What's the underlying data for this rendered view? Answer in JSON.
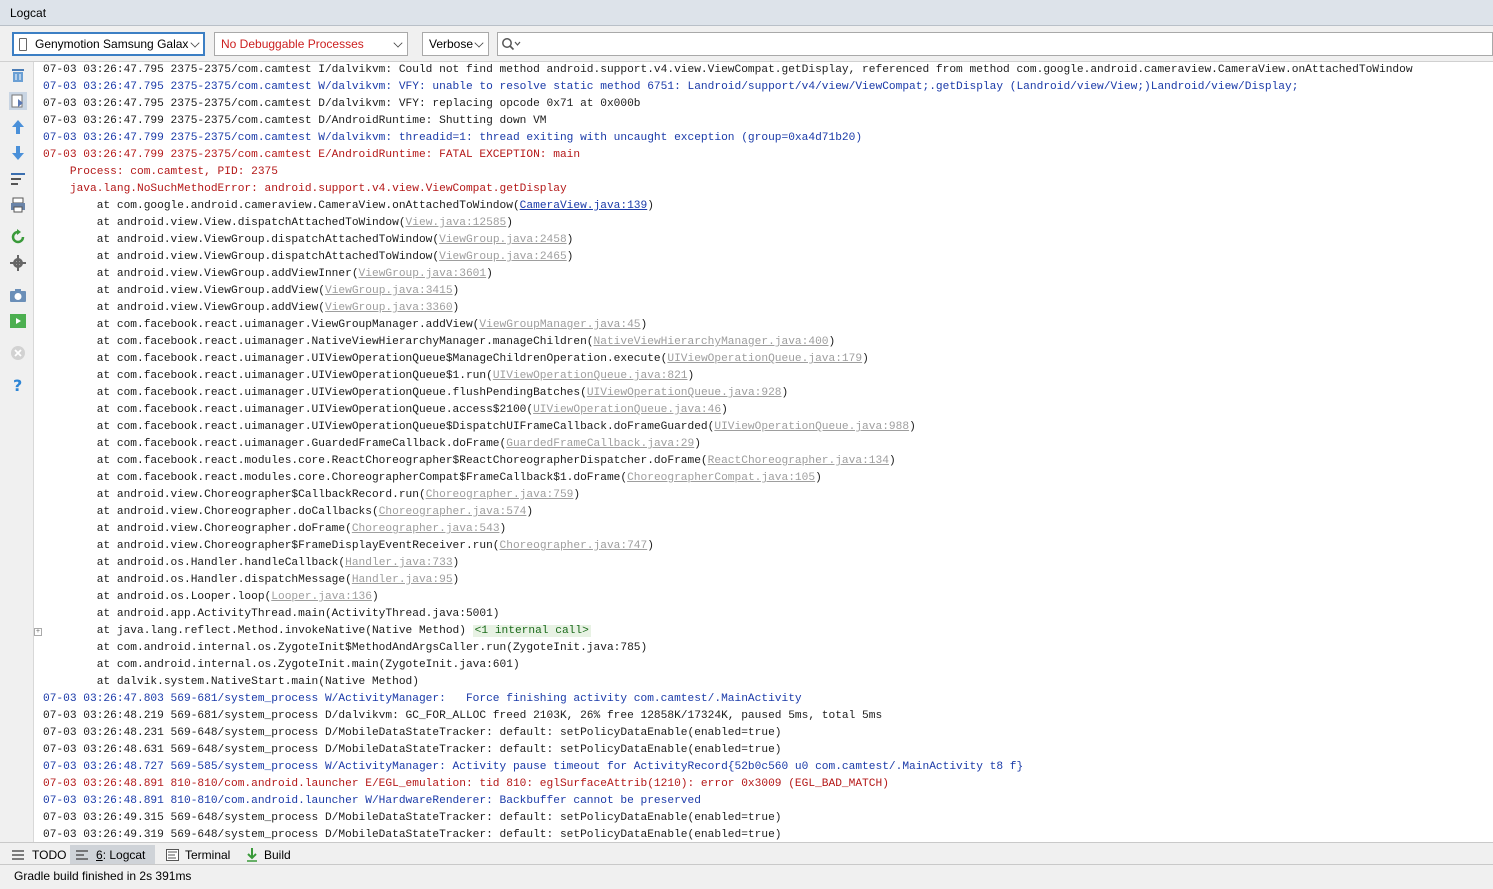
{
  "window": {
    "title": "Logcat"
  },
  "toolbar": {
    "device": "Genymotion Samsung Galax",
    "process": "No Debuggable Processes",
    "level": "Verbose",
    "search_value": ""
  },
  "sidebar": {
    "buttons": [
      "clear-logcat-icon",
      "scroll-to-end-icon",
      "up-arrow-icon",
      "down-arrow-icon",
      "soft-wraps-icon",
      "print-icon",
      "restart-icon",
      "settings-icon",
      "screenshot-icon",
      "screen-record-icon",
      "close-icon",
      "help-icon"
    ]
  },
  "log": {
    "lines": [
      {
        "level": "I",
        "text": "07-03 03:26:47.795 2375-2375/com.camtest I/dalvikvm: Could not find method android.support.v4.view.ViewCompat.getDisplay, referenced from method com.google.android.cameraview.CameraView.onAttachedToWindow"
      },
      {
        "level": "W",
        "text": "07-03 03:26:47.795 2375-2375/com.camtest W/dalvikvm: VFY: unable to resolve static method 6751: Landroid/support/v4/view/ViewCompat;.getDisplay (Landroid/view/View;)Landroid/view/Display;"
      },
      {
        "level": "D",
        "text": "07-03 03:26:47.795 2375-2375/com.camtest D/dalvikvm: VFY: replacing opcode 0x71 at 0x000b"
      },
      {
        "level": "D",
        "text": "07-03 03:26:47.799 2375-2375/com.camtest D/AndroidRuntime: Shutting down VM"
      },
      {
        "level": "W",
        "text": "07-03 03:26:47.799 2375-2375/com.camtest W/dalvikvm: threadid=1: thread exiting with uncaught exception (group=0xa4d71b20)"
      },
      {
        "level": "E",
        "text": "07-03 03:26:47.799 2375-2375/com.camtest E/AndroidRuntime: FATAL EXCEPTION: main"
      }
    ],
    "trace_header": [
      "    Process: com.camtest, PID: 2375",
      "    java.lang.NoSuchMethodError: android.support.v4.view.ViewCompat.getDisplay"
    ],
    "frames": [
      {
        "method": "        at com.google.android.cameraview.CameraView.onAttachedToWindow(",
        "link": "CameraView.java:139",
        "style": "blue",
        "close": ")"
      },
      {
        "method": "        at android.view.View.dispatchAttachedToWindow(",
        "link": "View.java:12585",
        "style": "gray",
        "close": ")"
      },
      {
        "method": "        at android.view.ViewGroup.dispatchAttachedToWindow(",
        "link": "ViewGroup.java:2458",
        "style": "gray",
        "close": ")"
      },
      {
        "method": "        at android.view.ViewGroup.dispatchAttachedToWindow(",
        "link": "ViewGroup.java:2465",
        "style": "gray",
        "close": ")"
      },
      {
        "method": "        at android.view.ViewGroup.addViewInner(",
        "link": "ViewGroup.java:3601",
        "style": "gray",
        "close": ")"
      },
      {
        "method": "        at android.view.ViewGroup.addView(",
        "link": "ViewGroup.java:3415",
        "style": "gray",
        "close": ")"
      },
      {
        "method": "        at android.view.ViewGroup.addView(",
        "link": "ViewGroup.java:3360",
        "style": "gray",
        "close": ")"
      },
      {
        "method": "        at com.facebook.react.uimanager.ViewGroupManager.addView(",
        "link": "ViewGroupManager.java:45",
        "style": "gray",
        "close": ")"
      },
      {
        "method": "        at com.facebook.react.uimanager.NativeViewHierarchyManager.manageChildren(",
        "link": "NativeViewHierarchyManager.java:400",
        "style": "gray",
        "close": ")"
      },
      {
        "method": "        at com.facebook.react.uimanager.UIViewOperationQueue$ManageChildrenOperation.execute(",
        "link": "UIViewOperationQueue.java:179",
        "style": "gray",
        "close": ")"
      },
      {
        "method": "        at com.facebook.react.uimanager.UIViewOperationQueue$1.run(",
        "link": "UIViewOperationQueue.java:821",
        "style": "gray",
        "close": ")"
      },
      {
        "method": "        at com.facebook.react.uimanager.UIViewOperationQueue.flushPendingBatches(",
        "link": "UIViewOperationQueue.java:928",
        "style": "gray",
        "close": ")"
      },
      {
        "method": "        at com.facebook.react.uimanager.UIViewOperationQueue.access$2100(",
        "link": "UIViewOperationQueue.java:46",
        "style": "gray",
        "close": ")"
      },
      {
        "method": "        at com.facebook.react.uimanager.UIViewOperationQueue$DispatchUIFrameCallback.doFrameGuarded(",
        "link": "UIViewOperationQueue.java:988",
        "style": "gray",
        "close": ")"
      },
      {
        "method": "        at com.facebook.react.uimanager.GuardedFrameCallback.doFrame(",
        "link": "GuardedFrameCallback.java:29",
        "style": "gray",
        "close": ")"
      },
      {
        "method": "        at com.facebook.react.modules.core.ReactChoreographer$ReactChoreographerDispatcher.doFrame(",
        "link": "ReactChoreographer.java:134",
        "style": "gray",
        "close": ")"
      },
      {
        "method": "        at com.facebook.react.modules.core.ChoreographerCompat$FrameCallback$1.doFrame(",
        "link": "ChoreographerCompat.java:105",
        "style": "gray",
        "close": ")"
      },
      {
        "method": "        at android.view.Choreographer$CallbackRecord.run(",
        "link": "Choreographer.java:759",
        "style": "gray",
        "close": ")"
      },
      {
        "method": "        at android.view.Choreographer.doCallbacks(",
        "link": "Choreographer.java:574",
        "style": "gray",
        "close": ")"
      },
      {
        "method": "        at android.view.Choreographer.doFrame(",
        "link": "Choreographer.java:543",
        "style": "gray",
        "close": ")"
      },
      {
        "method": "        at android.view.Choreographer$FrameDisplayEventReceiver.run(",
        "link": "Choreographer.java:747",
        "style": "gray",
        "close": ")"
      },
      {
        "method": "        at android.os.Handler.handleCallback(",
        "link": "Handler.java:733",
        "style": "gray",
        "close": ")"
      },
      {
        "method": "        at android.os.Handler.dispatchMessage(",
        "link": "Handler.java:95",
        "style": "gray",
        "close": ")"
      },
      {
        "method": "        at android.os.Looper.loop(",
        "link": "Looper.java:136",
        "style": "gray",
        "close": ")"
      },
      {
        "method": "        at android.app.ActivityThread.main(ActivityThread.java:5001)",
        "link": "",
        "style": "none",
        "close": ""
      }
    ],
    "internal_frame": {
      "method": "        at java.lang.reflect.Method.invokeNative(Native Method) ",
      "badge": "<1 internal call>"
    },
    "tail_frames": [
      "        at com.android.internal.os.ZygoteInit$MethodAndArgsCaller.run(ZygoteInit.java:785)",
      "        at com.android.internal.os.ZygoteInit.main(ZygoteInit.java:601)",
      "        at dalvik.system.NativeStart.main(Native Method)"
    ],
    "after_lines": [
      {
        "level": "W",
        "text": "07-03 03:26:47.803 569-681/system_process W/ActivityManager:   Force finishing activity com.camtest/.MainActivity"
      },
      {
        "level": "D",
        "text": "07-03 03:26:48.219 569-681/system_process D/dalvikvm: GC_FOR_ALLOC freed 2103K, 26% free 12858K/17324K, paused 5ms, total 5ms"
      },
      {
        "level": "D",
        "text": "07-03 03:26:48.231 569-648/system_process D/MobileDataStateTracker: default: setPolicyDataEnable(enabled=true)"
      },
      {
        "level": "D",
        "text": "07-03 03:26:48.631 569-648/system_process D/MobileDataStateTracker: default: setPolicyDataEnable(enabled=true)"
      },
      {
        "level": "W",
        "text": "07-03 03:26:48.727 569-585/system_process W/ActivityManager: Activity pause timeout for ActivityRecord{52b0c560 u0 com.camtest/.MainActivity t8 f}"
      },
      {
        "level": "E",
        "text": "07-03 03:26:48.891 810-810/com.android.launcher E/EGL_emulation: tid 810: eglSurfaceAttrib(1210): error 0x3009 (EGL_BAD_MATCH)"
      },
      {
        "level": "W",
        "text": "07-03 03:26:48.891 810-810/com.android.launcher W/HardwareRenderer: Backbuffer cannot be preserved"
      },
      {
        "level": "D",
        "text": "07-03 03:26:49.315 569-648/system_process D/MobileDataStateTracker: default: setPolicyDataEnable(enabled=true)"
      },
      {
        "level": "D",
        "text": "07-03 03:26:49.319 569-648/system_process D/MobileDataStateTracker: default: setPolicyDataEnable(enabled=true)"
      }
    ]
  },
  "tabs": {
    "todo": "TODO",
    "logcat_num": "6",
    "logcat": ": Logcat",
    "terminal": "Terminal",
    "build": "Build"
  },
  "status": {
    "text": "Gradle build finished in 2s 391ms"
  },
  "colors": {
    "warn": "#1a3aa8",
    "error": "#b41818",
    "accent": "#3c7fc4"
  }
}
